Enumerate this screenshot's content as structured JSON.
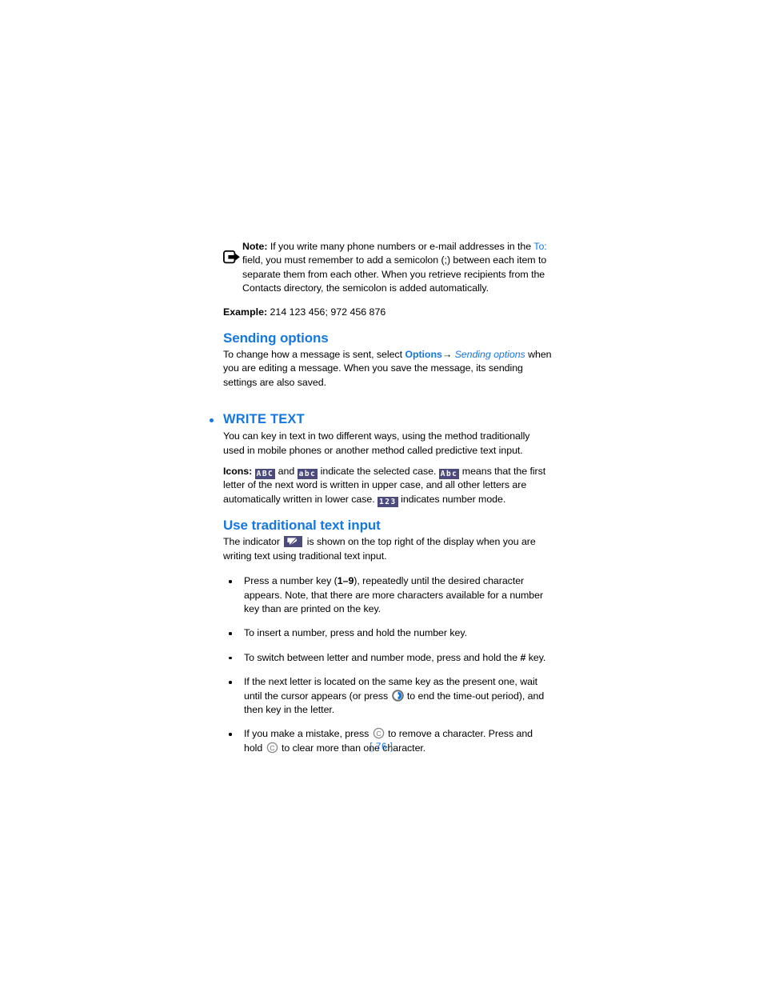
{
  "document": {
    "page_number_label": "[ 76 ]"
  },
  "note": {
    "icon": "note-arrow-icon",
    "lead_label": "Note:",
    "text_before_link": " If you write many phone numbers or e-mail addresses in the ",
    "link_text": "To:",
    "text_after_link": " field, you must remember to add a semicolon (;) between each item to separate them from each other. When you retrieve recipients from the Contacts directory, the semicolon is added automatically."
  },
  "example": {
    "label": "Example:",
    "value": " 214 123 456; 972 456 876"
  },
  "sending_options": {
    "heading": "Sending options",
    "text_1": "To change how a message is sent, select ",
    "menu_item": "Options",
    "arrow": "→",
    "menu_sub_item": " Sending options",
    "text_2": " when you are editing a message. When you save the message, its sending settings are also saved."
  },
  "write_text": {
    "heading": "WRITE TEXT",
    "intro": "You can key in text in two different ways, using the method traditionally used in mobile phones or another method called predictive text input.",
    "icons_label": "Icons:",
    "badge_abc_upper": "ABC",
    "icons_text_1": " and ",
    "badge_abc_lower": "abc",
    "icons_text_2": " indicate the selected case. ",
    "badge_abc_mixed": "Abc",
    "icons_text_3": " means that the first letter of the next word is written in upper case, and all other letters are automatically written in lower case. ",
    "badge_123": "123",
    "icons_text_4": " indicates number mode."
  },
  "traditional_input": {
    "heading": "Use traditional text input",
    "text_1": "The indicator ",
    "indicator_icon": "pen-writing-indicator-icon",
    "text_2": " is shown on the top right of the display when you are writing text using traditional text input.",
    "bullets": [
      {
        "id": "bullet-number-key",
        "text_1": "Press a number key (",
        "bold_1": "1–9",
        "text_2": "), repeatedly until the desired character appears. Note, that there are more characters available for a number key than are printed on the key."
      },
      {
        "id": "bullet-insert-number",
        "text_1": "To insert a number, press and hold the number key.",
        "bold_1": "",
        "text_2": ""
      },
      {
        "id": "bullet-switch-mode",
        "text_1": "To switch between letter and number mode, press and hold the ",
        "bold_1": "#",
        "text_2": " key."
      },
      {
        "id": "bullet-same-key",
        "text_1": "If the next letter is located on the same key as the present one, wait until the cursor appears (or press ",
        "icon": "scroll-key-icon",
        "text_2": " to end the time-out period), and then key in the letter."
      },
      {
        "id": "bullet-clear-key",
        "text_1": "If you make a mistake, press ",
        "icon": "clear-key-icon",
        "text_2": " to remove a character. Press and hold ",
        "icon_2": "clear-key-icon",
        "text_3": " to clear more than one character."
      }
    ]
  },
  "colors": {
    "accent_blue": "#1577e0",
    "badge_navy": "#4b4b7d",
    "key_icon_gray": "#8c8c8c",
    "key_icon_blue": "#1577e0",
    "text_black": "#000000"
  }
}
